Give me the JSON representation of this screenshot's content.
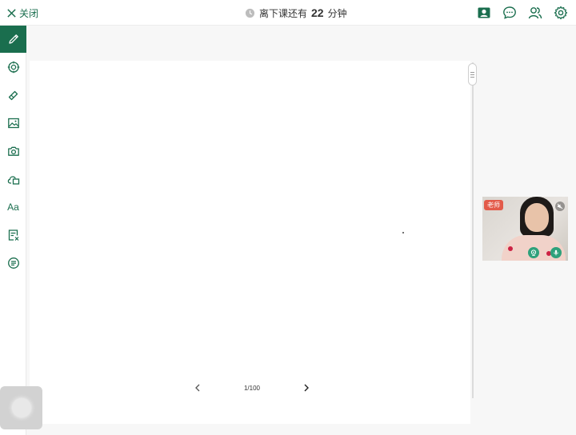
{
  "header": {
    "close_label": "关闭",
    "timer_prefix": "离下课还有",
    "timer_minutes": "22",
    "timer_suffix": "分钟",
    "icons": [
      "user-card-icon",
      "chat-icon",
      "users-icon",
      "settings-icon"
    ]
  },
  "toolbar": {
    "tools": [
      "pen-icon",
      "target-icon",
      "eraser-icon",
      "image-icon",
      "camera-icon",
      "cloud-file-icon",
      "text-tool",
      "clear-icon",
      "more-icon"
    ],
    "text_tool_label": "Aa",
    "active": "pen-icon"
  },
  "board": {
    "page_indicator": "1/100"
  },
  "video": {
    "role_label": "老师",
    "icons": [
      "volume-off-icon",
      "camera-on-icon",
      "mic-on-icon"
    ]
  },
  "colors": {
    "brand": "#1a6e4e",
    "badge": "#e35b4a",
    "status": "#2ea17b"
  }
}
